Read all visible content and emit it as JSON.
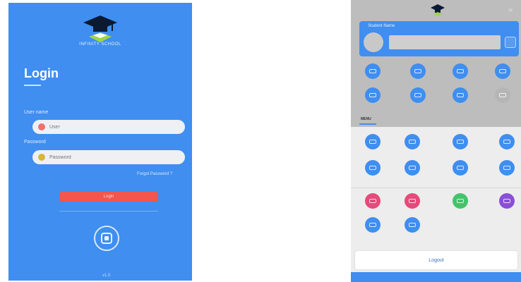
{
  "login_screen": {
    "logo_text": "INFINITY SCHOOL",
    "title": "Login",
    "username_label": "User name",
    "username_placeholder": "User",
    "password_label": "Password",
    "password_placeholder": "Password",
    "forgot_password": "Forgot Password ?",
    "login_button": "Login",
    "version": "v1.0"
  },
  "dashboard_screen": {
    "profile_name": "Student Name",
    "top_grid_icons": [
      "dashboard",
      "profile",
      "attendance",
      "timetable",
      "exam",
      "homework",
      "notice",
      "fees"
    ],
    "tab_label": "MENU",
    "menu_grid_icons": [
      "events",
      "gallery",
      "calendar",
      "library",
      "transport",
      "assignment",
      "leave",
      "results"
    ],
    "extra_grid_icons": [
      "chat",
      "message",
      "gift",
      "games",
      "settings",
      "about"
    ],
    "logout_button": "Logout",
    "colors": {
      "primary": "#3f8ef0",
      "login_button": "#f2564c",
      "pink": "#e64a7b",
      "green": "#43c46b",
      "purple": "#8a4fd8",
      "disabled": "#b5b5b5"
    }
  }
}
